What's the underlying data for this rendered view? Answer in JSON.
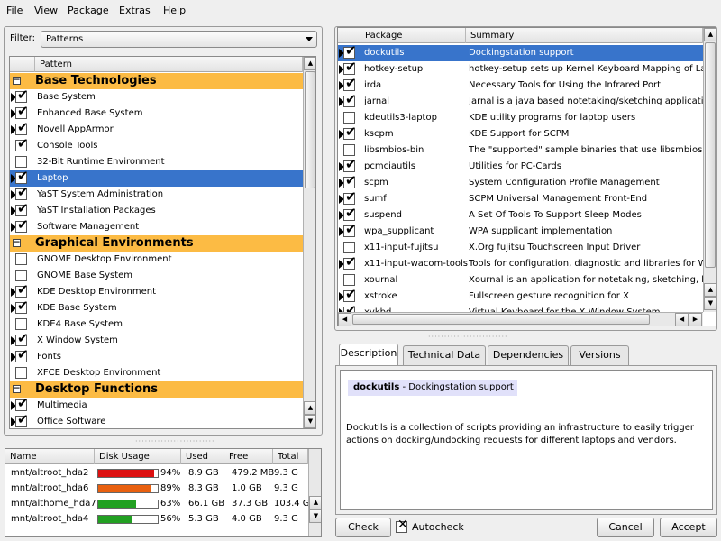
{
  "menu": [
    "File",
    "View",
    "Package",
    "Extras",
    "Help"
  ],
  "filter": {
    "label": "Filter:",
    "value": "Patterns"
  },
  "patterns": {
    "header": "Pattern",
    "rows": [
      {
        "type": "cat",
        "label": "Base Technologies"
      },
      {
        "type": "item",
        "label": "Base System",
        "checked": true,
        "arrow": true,
        "sel": false
      },
      {
        "type": "item",
        "label": "Enhanced Base System",
        "checked": true,
        "arrow": true,
        "sel": false
      },
      {
        "type": "item",
        "label": "Novell AppArmor",
        "checked": true,
        "arrow": true,
        "sel": false
      },
      {
        "type": "item",
        "label": "Console Tools",
        "checked": true,
        "arrow": false,
        "sel": false
      },
      {
        "type": "item",
        "label": "32-Bit Runtime Environment",
        "checked": false,
        "arrow": false,
        "sel": false
      },
      {
        "type": "item",
        "label": "Laptop",
        "checked": true,
        "arrow": true,
        "sel": true
      },
      {
        "type": "item",
        "label": "YaST System Administration",
        "checked": true,
        "arrow": true,
        "sel": false
      },
      {
        "type": "item",
        "label": "YaST Installation Packages",
        "checked": true,
        "arrow": true,
        "sel": false
      },
      {
        "type": "item",
        "label": "Software Management",
        "checked": true,
        "arrow": true,
        "sel": false
      },
      {
        "type": "cat",
        "label": "Graphical Environments"
      },
      {
        "type": "item",
        "label": "GNOME Desktop Environment",
        "checked": false,
        "arrow": false,
        "sel": false
      },
      {
        "type": "item",
        "label": "GNOME Base System",
        "checked": false,
        "arrow": false,
        "sel": false
      },
      {
        "type": "item",
        "label": "KDE Desktop Environment",
        "checked": true,
        "arrow": true,
        "sel": false
      },
      {
        "type": "item",
        "label": "KDE Base System",
        "checked": true,
        "arrow": true,
        "sel": false
      },
      {
        "type": "item",
        "label": "KDE4 Base System",
        "checked": false,
        "arrow": false,
        "sel": false
      },
      {
        "type": "item",
        "label": "X Window System",
        "checked": true,
        "arrow": true,
        "sel": false
      },
      {
        "type": "item",
        "label": "Fonts",
        "checked": true,
        "arrow": true,
        "sel": false
      },
      {
        "type": "item",
        "label": "XFCE Desktop Environment",
        "checked": false,
        "arrow": false,
        "sel": false
      },
      {
        "type": "cat",
        "label": "Desktop Functions"
      },
      {
        "type": "item",
        "label": "Multimedia",
        "checked": true,
        "arrow": true,
        "sel": false
      },
      {
        "type": "item",
        "label": "Office Software",
        "checked": true,
        "arrow": true,
        "sel": false
      }
    ]
  },
  "disk": {
    "headers": [
      "Name",
      "Disk Usage",
      "Used",
      "Free",
      "Total"
    ],
    "rows": [
      {
        "name": "mnt/altroot_hda2",
        "pct": "94%",
        "fill": 0.94,
        "color": "#dd1111",
        "used": "8.9 GB",
        "free": "479.2 MB",
        "total": "9.3 G"
      },
      {
        "name": "mnt/altroot_hda6",
        "pct": "89%",
        "fill": 0.89,
        "color": "#e86010",
        "used": "8.3 GB",
        "free": "1.0 GB",
        "total": "9.3 G"
      },
      {
        "name": "mnt/althome_hda7",
        "pct": "63%",
        "fill": 0.63,
        "color": "#22a022",
        "used": "66.1 GB",
        "free": "37.3 GB",
        "total": "103.4 G"
      },
      {
        "name": "mnt/altroot_hda4",
        "pct": "56%",
        "fill": 0.56,
        "color": "#22a022",
        "used": "5.3 GB",
        "free": "4.0 GB",
        "total": "9.3 G"
      }
    ]
  },
  "packages": {
    "headers": [
      "Package",
      "Summary"
    ],
    "rows": [
      {
        "name": "dockutils",
        "summary": "Dockingstation support",
        "checked": true,
        "arrow": true,
        "sel": true
      },
      {
        "name": "hotkey-setup",
        "summary": "hotkey-setup sets up Kernel Keyboard Mapping of La",
        "checked": true,
        "arrow": true,
        "sel": false
      },
      {
        "name": "irda",
        "summary": "Necessary Tools for Using the Infrared Port",
        "checked": true,
        "arrow": true,
        "sel": false
      },
      {
        "name": "jarnal",
        "summary": "Jarnal is a java based notetaking/sketching application",
        "checked": true,
        "arrow": true,
        "sel": false
      },
      {
        "name": "kdeutils3-laptop",
        "summary": "KDE utility programs for laptop users",
        "checked": false,
        "arrow": false,
        "sel": false
      },
      {
        "name": "kscpm",
        "summary": "KDE Support for SCPM",
        "checked": true,
        "arrow": true,
        "sel": false
      },
      {
        "name": "libsmbios-bin",
        "summary": "The \"supported\" sample binaries that use libsmbios",
        "checked": false,
        "arrow": false,
        "sel": false
      },
      {
        "name": "pcmciautils",
        "summary": "Utilities for PC-Cards",
        "checked": true,
        "arrow": true,
        "sel": false
      },
      {
        "name": "scpm",
        "summary": "System Configuration Profile Management",
        "checked": true,
        "arrow": true,
        "sel": false
      },
      {
        "name": "sumf",
        "summary": "SCPM Universal Management Front-End",
        "checked": true,
        "arrow": true,
        "sel": false
      },
      {
        "name": "suspend",
        "summary": "A Set Of Tools To Support Sleep Modes",
        "checked": true,
        "arrow": true,
        "sel": false
      },
      {
        "name": "wpa_supplicant",
        "summary": "WPA supplicant implementation",
        "checked": true,
        "arrow": true,
        "sel": false
      },
      {
        "name": "x11-input-fujitsu",
        "summary": "X.Org fujitsu Touchscreen Input Driver",
        "checked": false,
        "arrow": false,
        "sel": false
      },
      {
        "name": "x11-input-wacom-tools",
        "summary": "Tools for configuration, diagnostic and libraries for Wac",
        "checked": true,
        "arrow": true,
        "sel": false
      },
      {
        "name": "xournal",
        "summary": "Xournal is an application for notetaking, sketching, kee",
        "checked": false,
        "arrow": false,
        "sel": false
      },
      {
        "name": "xstroke",
        "summary": "Fullscreen gesture recognition for X",
        "checked": true,
        "arrow": true,
        "sel": false
      },
      {
        "name": "xvkbd",
        "summary": "Virtual Keyboard for the X Window System",
        "checked": true,
        "arrow": true,
        "sel": false
      }
    ]
  },
  "tabs": [
    "Description",
    "Technical Data",
    "Dependencies",
    "Versions"
  ],
  "description": {
    "name": "dockutils",
    "summary": " - Dockingstation support",
    "body": "Dockutils is a collection of scripts providing an infrastructure to easily trigger actions on docking/undocking requests for different laptops and vendors."
  },
  "buttons": {
    "check": "Check",
    "autocheck": "Autocheck",
    "cancel": "Cancel",
    "accept": "Accept"
  }
}
